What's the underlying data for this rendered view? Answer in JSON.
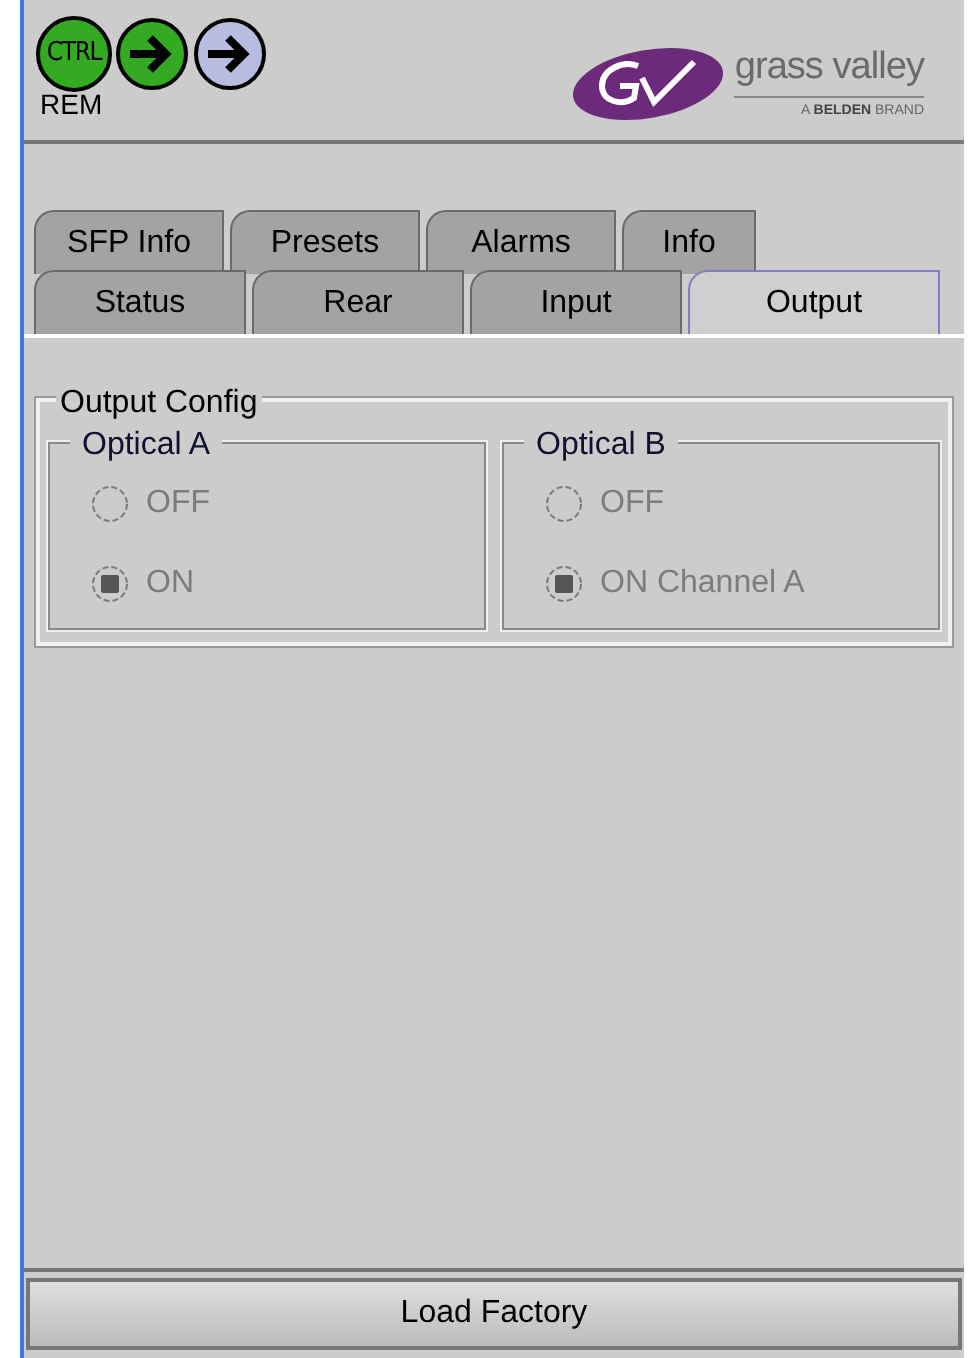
{
  "header": {
    "status_icons": [
      {
        "kind": "ctrl",
        "label": "CTRL",
        "color": "#33aa22"
      },
      {
        "kind": "arrow",
        "color": "#33aa22"
      },
      {
        "kind": "arrow",
        "color": "#b8bce0"
      }
    ],
    "status_caption": "REM",
    "logo": {
      "name": "grass valley",
      "tagline_prefix": "A ",
      "tagline_brand": "BELDEN",
      "tagline_suffix": " BRAND"
    }
  },
  "tab_rows": [
    [
      {
        "label": "SFP Info",
        "selected": false
      },
      {
        "label": "Presets",
        "selected": false
      },
      {
        "label": "Alarms",
        "selected": false
      },
      {
        "label": "Info",
        "selected": false
      }
    ],
    [
      {
        "label": "Status",
        "selected": false
      },
      {
        "label": "Rear",
        "selected": false
      },
      {
        "label": "Input",
        "selected": false
      },
      {
        "label": "Output",
        "selected": true
      }
    ]
  ],
  "output_config": {
    "title": "Output Config",
    "groups": [
      {
        "title": "Optical A",
        "options": [
          {
            "label": "OFF",
            "selected": false,
            "disabled": true
          },
          {
            "label": "ON",
            "selected": true,
            "disabled": true
          }
        ]
      },
      {
        "title": "Optical B",
        "options": [
          {
            "label": "OFF",
            "selected": false,
            "disabled": true
          },
          {
            "label": "ON Channel A",
            "selected": true,
            "disabled": true
          }
        ]
      }
    ]
  },
  "footer_button": "Load Factory"
}
